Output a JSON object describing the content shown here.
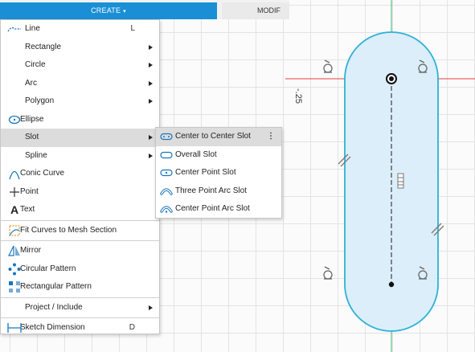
{
  "toolbar": {
    "create_label": "CREATE",
    "create_caret": "▾",
    "modify_label": "MODIF"
  },
  "create_menu": {
    "items": [
      {
        "label": "Line",
        "shortcut": "L",
        "icon": "line-icon"
      },
      {
        "label": "Rectangle",
        "submenu": true
      },
      {
        "label": "Circle",
        "submenu": true
      },
      {
        "label": "Arc",
        "submenu": true
      },
      {
        "label": "Polygon",
        "submenu": true
      },
      {
        "label": "Ellipse",
        "icon": "ellipse-icon"
      },
      {
        "label": "Slot",
        "submenu": true,
        "highlighted": true
      },
      {
        "label": "Spline",
        "submenu": true
      },
      {
        "label": "Conic Curve",
        "icon": "conic-curve-icon"
      },
      {
        "label": "Point",
        "icon": "point-icon"
      },
      {
        "label": "Text",
        "icon": "text-icon"
      },
      {
        "label": "Fit Curves to Mesh Section",
        "icon": "fit-curves-icon"
      },
      {
        "label": "Mirror",
        "icon": "mirror-icon"
      },
      {
        "label": "Circular Pattern",
        "icon": "circular-pattern-icon"
      },
      {
        "label": "Rectangular Pattern",
        "icon": "rectangular-pattern-icon"
      },
      {
        "label": "Project / Include",
        "submenu": true
      },
      {
        "label": "Sketch Dimension",
        "shortcut": "D",
        "icon": "sketch-dimension-icon"
      }
    ]
  },
  "slot_menu": {
    "items": [
      {
        "label": "Center to Center Slot",
        "icon": "center-to-center-slot-icon",
        "highlighted": true,
        "more": "⋮"
      },
      {
        "label": "Overall Slot",
        "icon": "overall-slot-icon"
      },
      {
        "label": "Center Point Slot",
        "icon": "center-point-slot-icon"
      },
      {
        "label": "Three Point Arc Slot",
        "icon": "three-point-arc-slot-icon"
      },
      {
        "label": "Center Point Arc Slot",
        "icon": "center-point-arc-slot-icon"
      }
    ]
  },
  "canvas": {
    "dimension_text": "-.25"
  },
  "colors": {
    "accent": "#1a8fd6",
    "slot_stroke": "#2eb1d6",
    "slot_fill": "#dbeef9",
    "x_axis": "#e04040",
    "y_axis": "#3cb371",
    "icon_blue": "#1b75bb"
  }
}
